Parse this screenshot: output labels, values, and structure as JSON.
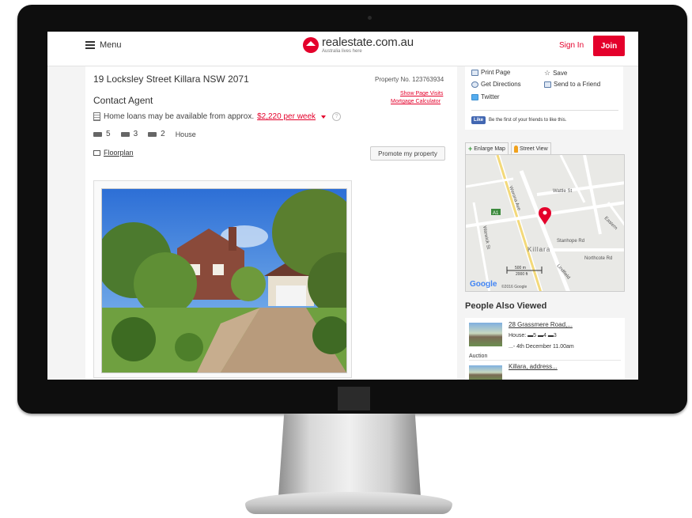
{
  "header": {
    "menu_label": "Menu",
    "logo_text": "realestate.com.au",
    "logo_tagline": "Australia lives here",
    "signin_label": "Sign In",
    "join_label": "Join"
  },
  "property": {
    "address": "19 Locksley Street Killara NSW 2071",
    "property_no": "Property No. 123763934",
    "show_visits": "Show Page Visits",
    "mortgage_calc": "Mortgage Calculator",
    "price": "Contact Agent",
    "loans_text": "Home loans may be available from approx.",
    "loans_amount": "$2,220 per week",
    "bedrooms": "5",
    "bathrooms": "3",
    "parking": "2",
    "type": "House",
    "floorplan_label": "Floorplan",
    "promote_label": "Promote my property"
  },
  "sidebar": {
    "print_page": "Print Page",
    "save": "Save",
    "get_directions": "Get Directions",
    "send_to_friend": "Send to a Friend",
    "twitter": "Twitter",
    "fb_like": "Like",
    "fb_text": "Be the first of your friends to like this.",
    "enlarge_map": "Enlarge Map",
    "street_view": "Street View"
  },
  "map": {
    "streets": [
      "Wattle St",
      "Werona Ave",
      "Warwick St",
      "Stanhope Rd",
      "Northcote Rd",
      "Lindfield",
      "Killara",
      "A1",
      "Eastern"
    ],
    "scale_m": "500 m",
    "scale_ft": "2000 ft",
    "copyright": "©2016 Google",
    "google": "Google"
  },
  "people_also_viewed": {
    "title": "People Also Viewed",
    "items": [
      {
        "title": "28 Grassmere Road,...",
        "type_line": "House:",
        "beds": "5",
        "baths": "4",
        "cars": "3",
        "date_line": "...- 4th December 11.00am",
        "label": "Auction"
      },
      {
        "title": "Killara, address..."
      }
    ]
  },
  "colors": {
    "brand": "#e4002b",
    "facebook": "#4267b2"
  }
}
